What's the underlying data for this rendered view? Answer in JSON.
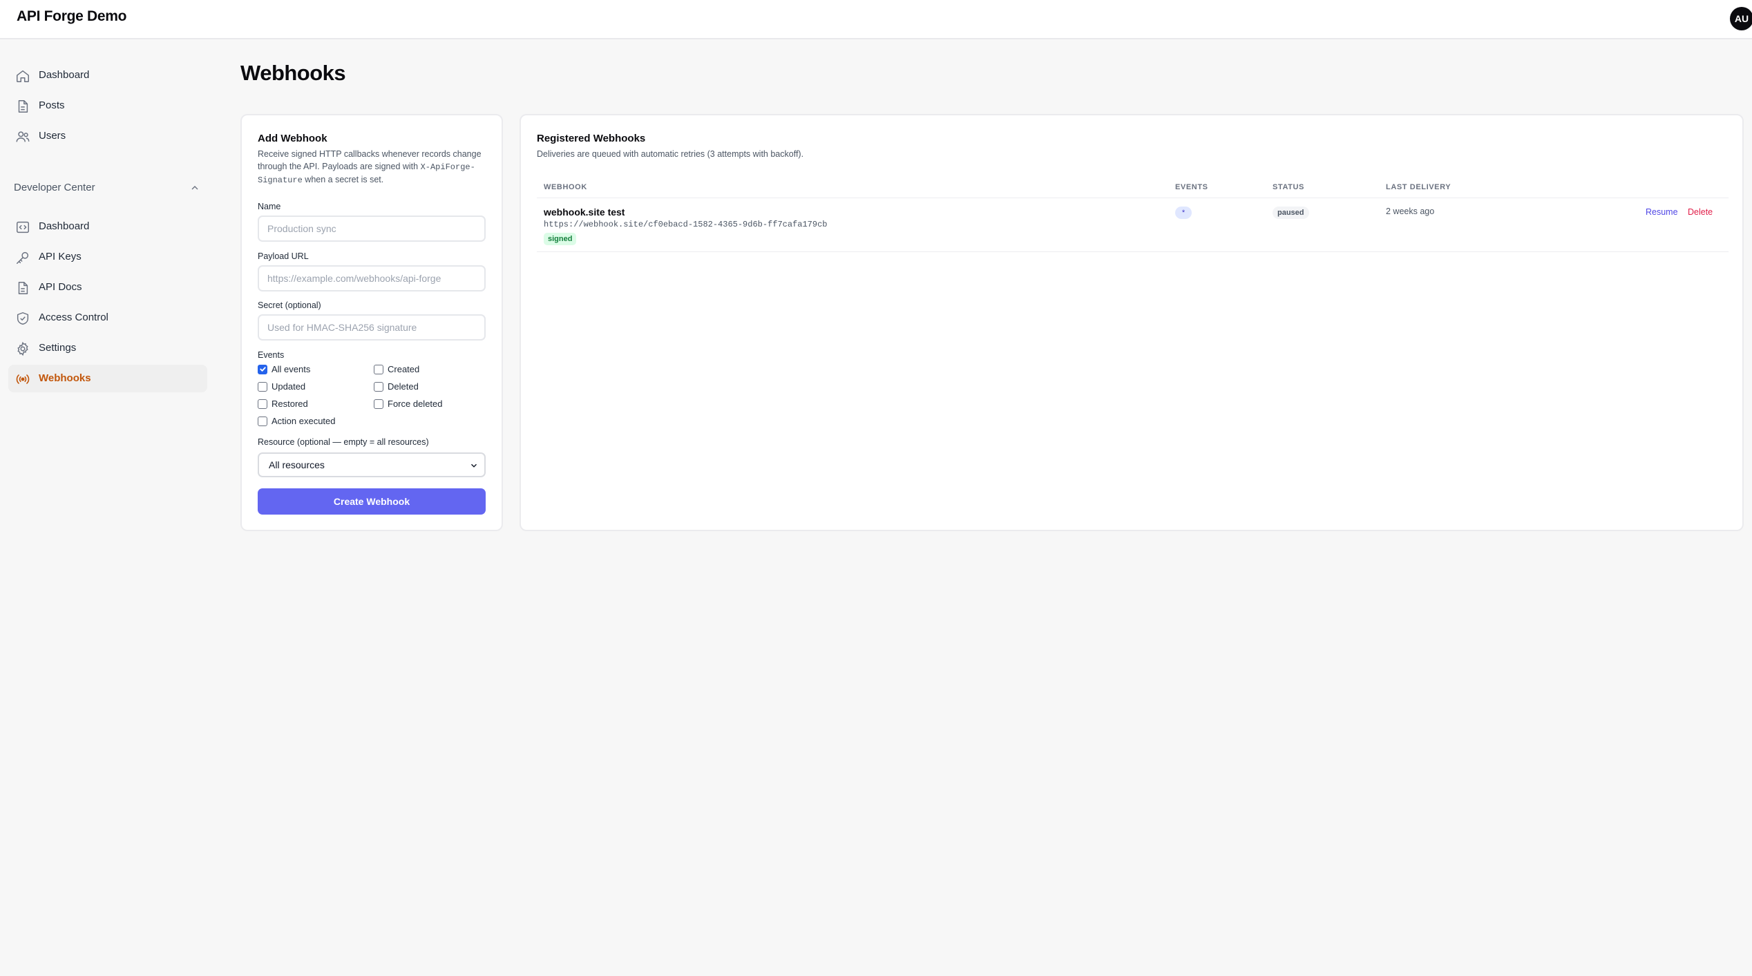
{
  "app": {
    "title": "API Forge Demo",
    "avatar_initials": "AU"
  },
  "sidebar": {
    "main_items": [
      {
        "label": "Dashboard",
        "icon": "home-icon"
      },
      {
        "label": "Posts",
        "icon": "document-icon"
      },
      {
        "label": "Users",
        "icon": "users-icon"
      }
    ],
    "section": {
      "label": "Developer Center",
      "expanded": true
    },
    "dev_items": [
      {
        "label": "Dashboard",
        "icon": "code-icon"
      },
      {
        "label": "API Keys",
        "icon": "key-icon"
      },
      {
        "label": "API Docs",
        "icon": "document-icon"
      },
      {
        "label": "Access Control",
        "icon": "shield-icon"
      },
      {
        "label": "Settings",
        "icon": "gear-icon"
      },
      {
        "label": "Webhooks",
        "icon": "broadcast-icon",
        "active": true
      }
    ],
    "active_color": "#c2570c"
  },
  "page": {
    "title": "Webhooks"
  },
  "add_form": {
    "title": "Add Webhook",
    "description_line1": "Receive signed HTTP callbacks whenever records change",
    "description_line2_prefix": "through the API. Payloads are signed with ",
    "description_code_1": "X-ApiForge-",
    "description_code_2": "Signature",
    "description_line3_suffix": " when a secret is set.",
    "name": {
      "label": "Name",
      "placeholder": "Production sync",
      "value": ""
    },
    "url": {
      "label": "Payload URL",
      "placeholder": "https://example.com/webhooks/api-forge",
      "value": ""
    },
    "secret": {
      "label": "Secret (optional)",
      "placeholder": "Used for HMAC-SHA256 signature",
      "value": ""
    },
    "events_label": "Events",
    "events": [
      {
        "label": "All events",
        "checked": true
      },
      {
        "label": "Created",
        "checked": false
      },
      {
        "label": "Updated",
        "checked": false
      },
      {
        "label": "Deleted",
        "checked": false
      },
      {
        "label": "Restored",
        "checked": false
      },
      {
        "label": "Force deleted",
        "checked": false
      },
      {
        "label": "Action executed",
        "checked": false
      }
    ],
    "resource_label": "Resource (optional — empty = all resources)",
    "resource_selected": "All resources",
    "submit_label": "Create Webhook",
    "accent": "#6366f1"
  },
  "registered": {
    "title": "Registered Webhooks",
    "description": "Deliveries are queued with automatic retries (3 attempts with backoff).",
    "columns": [
      "WEBHOOK",
      "EVENTS",
      "STATUS",
      "LAST DELIVERY"
    ],
    "rows": [
      {
        "name": "webhook.site test",
        "url": "https://webhook.site/cf0ebacd-1582-4365-9d6b-ff7cafa179cb",
        "signed_badge": "signed",
        "events": "*",
        "status": "paused",
        "last_delivery": "2 weeks ago",
        "resume_label": "Resume",
        "delete_label": "Delete"
      }
    ]
  }
}
